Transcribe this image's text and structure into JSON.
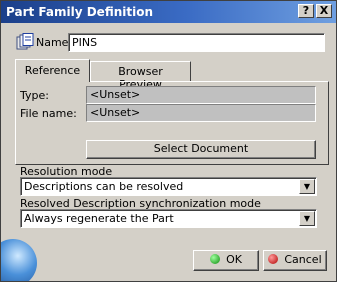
{
  "window": {
    "title": "Part Family Definition",
    "help_label": "?",
    "close_label": "X"
  },
  "name": {
    "label": "Name:",
    "value": "PINS"
  },
  "tabs": [
    {
      "label": "Reference",
      "active": true
    },
    {
      "label": "Browser Preview",
      "active": false
    }
  ],
  "reference": {
    "type_label": "Type:",
    "type_value": "<Unset>",
    "file_label": "File name:",
    "file_value": "<Unset>",
    "select_button": "Select Document"
  },
  "resolution": {
    "label": "Resolution mode",
    "value": "Descriptions can be resolved"
  },
  "sync": {
    "label": "Resolved Description synchronization mode",
    "value": "Always regenerate the Part"
  },
  "footer": {
    "ok": "OK",
    "cancel": "Cancel"
  },
  "colors": {
    "titlebar": "#1b3f8a",
    "ok_dot": "#0a8a0a",
    "cancel_dot": "#b00000"
  }
}
